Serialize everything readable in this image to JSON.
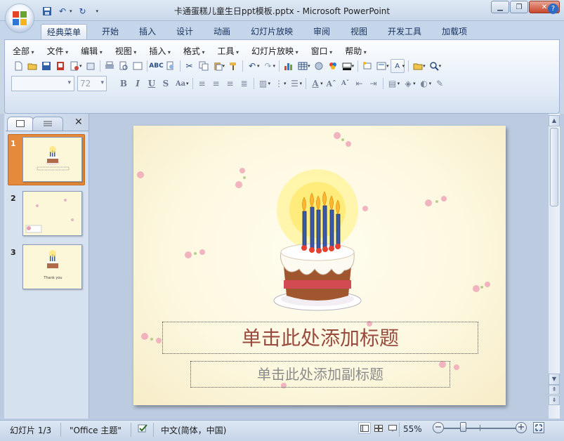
{
  "window": {
    "title": "卡通蛋糕儿童生日ppt模板.pptx - Microsoft PowerPoint",
    "buttons": [
      "minimize",
      "restore",
      "close"
    ]
  },
  "ribbon_tabs": [
    {
      "label": "经典菜单",
      "active": true
    },
    {
      "label": "开始"
    },
    {
      "label": "插入"
    },
    {
      "label": "设计"
    },
    {
      "label": "动画"
    },
    {
      "label": "幻灯片放映"
    },
    {
      "label": "审阅"
    },
    {
      "label": "视图"
    },
    {
      "label": "开发工具"
    },
    {
      "label": "加载项"
    }
  ],
  "classic_menu": [
    "全部",
    "文件",
    "编辑",
    "视图",
    "插入",
    "格式",
    "工具",
    "幻灯片放映",
    "窗口",
    "帮助"
  ],
  "format_toolbar": {
    "font_name": "",
    "font_size": "72"
  },
  "slides_pane": {
    "slides": [
      {
        "number": "1",
        "selected": true
      },
      {
        "number": "2"
      },
      {
        "number": "3",
        "caption": "Thank you"
      }
    ]
  },
  "slide": {
    "title_placeholder": "单击此处添加标题",
    "subtitle_placeholder": "单击此处添加副标题"
  },
  "status_bar": {
    "slide_info": "幻灯片 1/3",
    "theme": "\"Office 主题\"",
    "language": "中文(简体，中国)",
    "zoom": "55%"
  },
  "colors": {
    "accent_orange": "#e58a3b",
    "title_text": "#9a4b3f",
    "ribbon_blue": "#c6d6ea"
  },
  "icons": [
    "office-button-icon",
    "save-icon",
    "undo-icon",
    "redo-icon",
    "customize-qat-icon",
    "help-icon",
    "new-icon",
    "open-icon",
    "print-icon",
    "cut-icon",
    "copy-icon",
    "paste-icon",
    "chart-icon",
    "table-icon",
    "zoom-icon"
  ]
}
